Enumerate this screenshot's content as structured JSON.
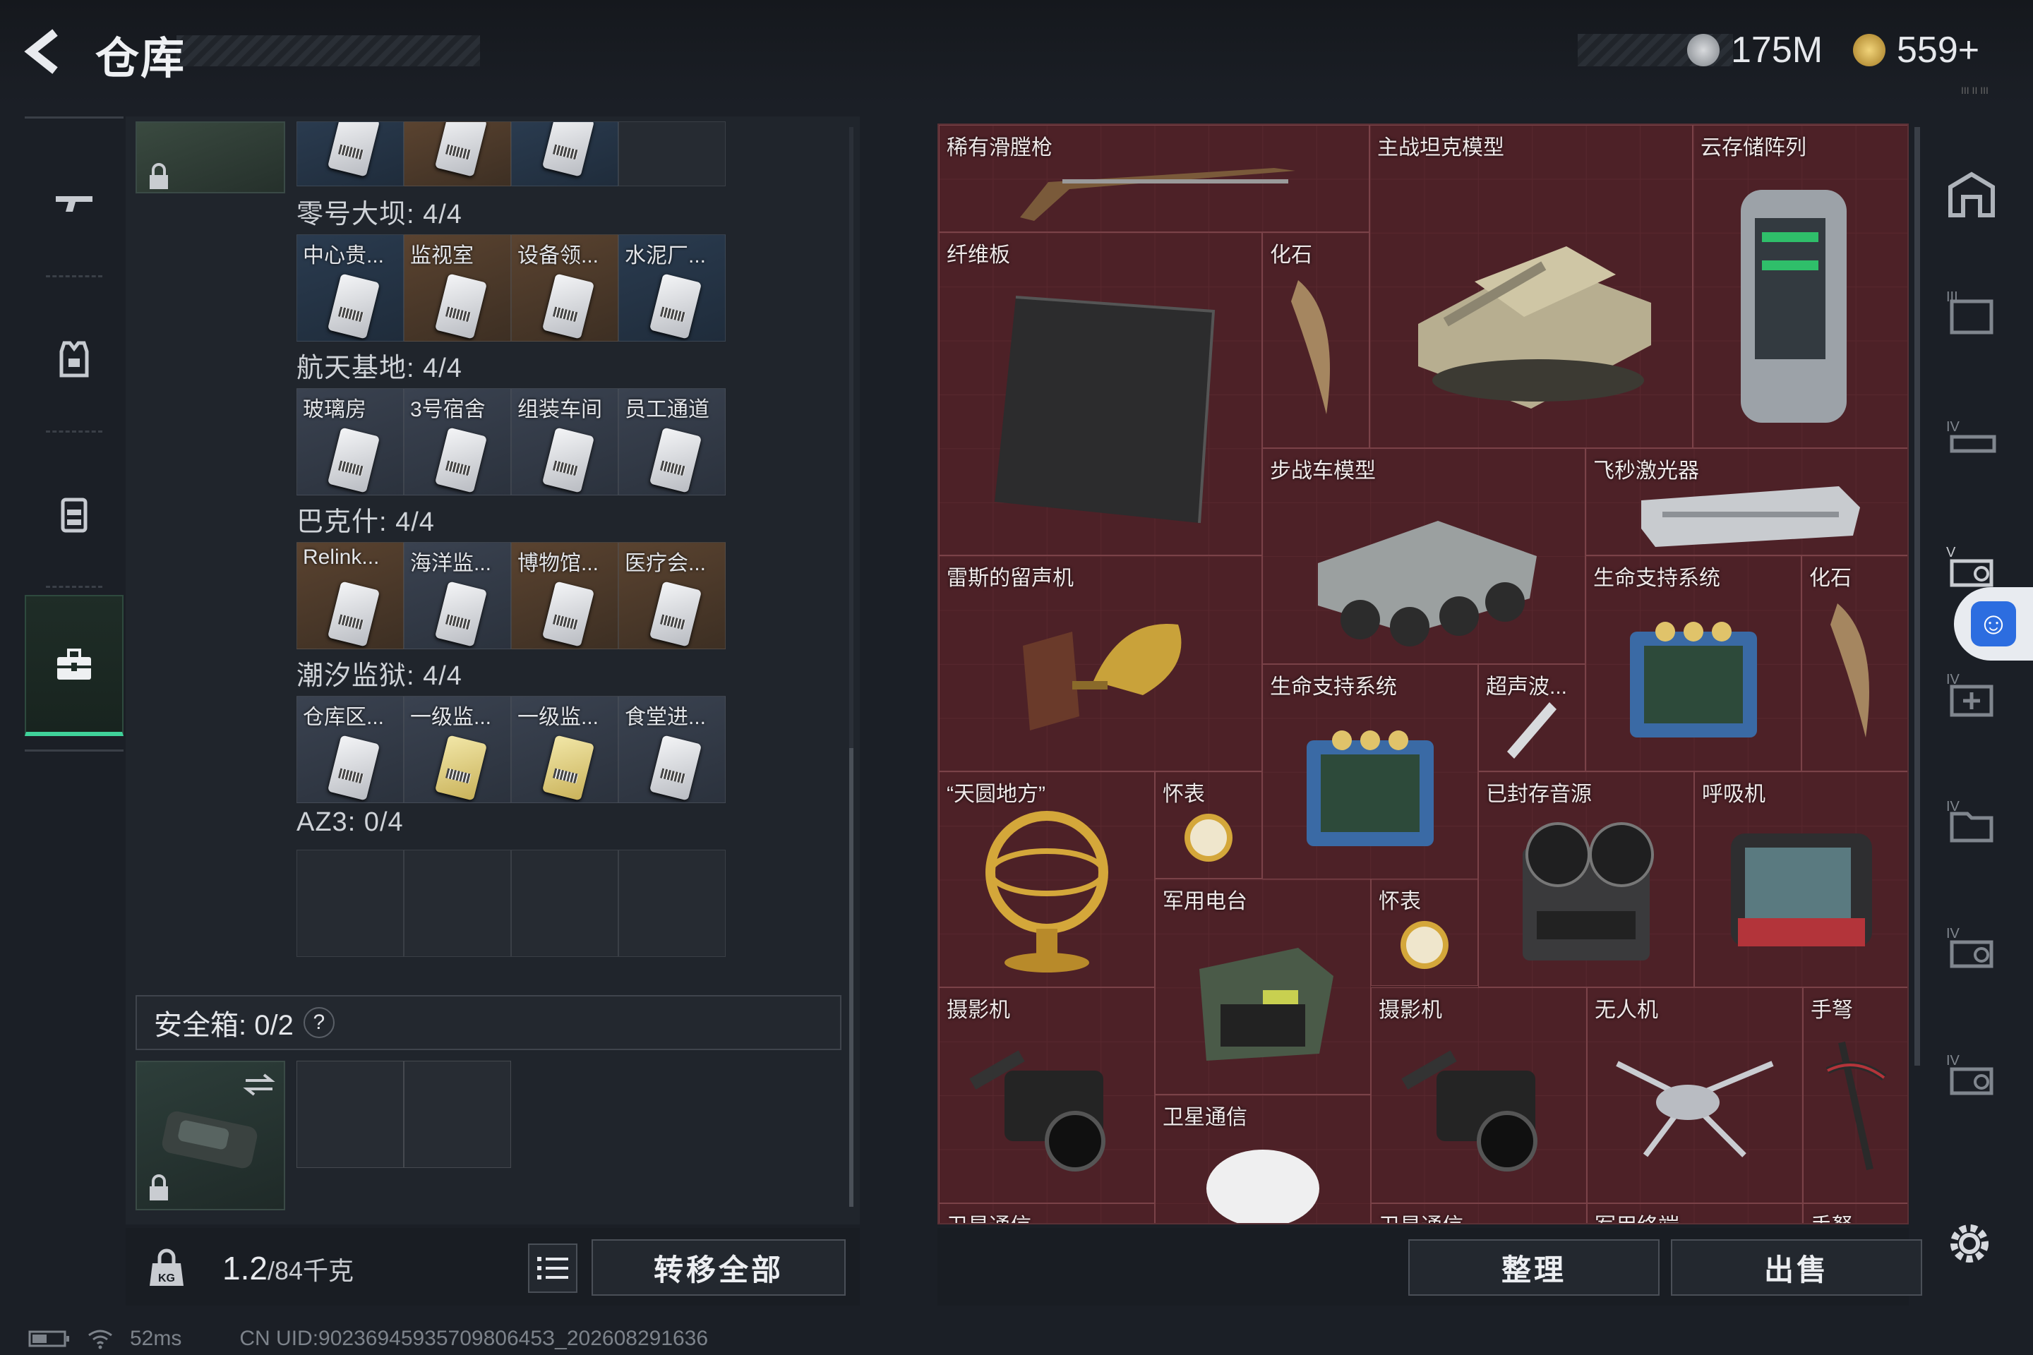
{
  "header": {
    "back_icon": "chevron-left-icon",
    "title": "仓库",
    "currency1": {
      "value": "175M",
      "icon": "silver-coin-icon"
    },
    "currency2": {
      "value": "559+",
      "icon": "gold-coin-icon"
    },
    "tiny_text": "III II III"
  },
  "leftnav": {
    "items": [
      {
        "icon": "gun-icon"
      },
      {
        "icon": "vest-icon"
      },
      {
        "icon": "backpack-icon"
      },
      {
        "icon": "toolbox-icon",
        "active": true
      }
    ]
  },
  "keycards": {
    "groups": [
      {
        "label": "零号大坝: 4/4",
        "cards": [
          {
            "label": "中心贵..."
          },
          {
            "label": "监视室"
          },
          {
            "label": "设备领..."
          },
          {
            "label": "水泥厂..."
          }
        ]
      },
      {
        "label": "航天基地: 4/4",
        "cards": [
          {
            "label": "玻璃房"
          },
          {
            "label": "3号宿舍"
          },
          {
            "label": "组装车间"
          },
          {
            "label": "员工通道"
          }
        ]
      },
      {
        "label": "巴克什: 4/4",
        "cards": [
          {
            "label": "Relink..."
          },
          {
            "label": "海洋监..."
          },
          {
            "label": "博物馆..."
          },
          {
            "label": "医疗会..."
          }
        ]
      },
      {
        "label": "潮汐监狱: 4/4",
        "cards": [
          {
            "label": "仓库区..."
          },
          {
            "label": "一级监..."
          },
          {
            "label": "一级监..."
          },
          {
            "label": "食堂进..."
          }
        ]
      },
      {
        "label": "AZ3: 0/4",
        "cards": []
      }
    ]
  },
  "safebox": {
    "label": "安全箱: 0/2",
    "help": "?"
  },
  "bottom": {
    "weight": "1.2",
    "weight_max": "/84千克",
    "transfer_all": "转移全部",
    "list_icon": "list-icon",
    "lock_icon": "weight-lock-icon"
  },
  "stash": {
    "items": [
      {
        "label": "稀有滑膛枪"
      },
      {
        "label": "主战坦克模型"
      },
      {
        "label": "云存储阵列"
      },
      {
        "label": "纤维板"
      },
      {
        "label": "化石"
      },
      {
        "label": "步战车模型"
      },
      {
        "label": "飞秒激光器"
      },
      {
        "label": "雷斯的留声机"
      },
      {
        "label": "生命支持系统"
      },
      {
        "label": "化石"
      },
      {
        "label": "生命支持系统"
      },
      {
        "label": "超声波..."
      },
      {
        "label": "“天圆地方”"
      },
      {
        "label": "怀表"
      },
      {
        "label": "已封存音源"
      },
      {
        "label": "呼吸机"
      },
      {
        "label": "军用电台"
      },
      {
        "label": "怀表"
      },
      {
        "label": "摄影机"
      },
      {
        "label": "摄影机"
      },
      {
        "label": "无人机"
      },
      {
        "label": "手弩"
      },
      {
        "label": "卫星通信"
      },
      {
        "label": "卫星通信"
      },
      {
        "label": "卫星通信"
      },
      {
        "label": "军用终端"
      },
      {
        "label": "手弩"
      }
    ]
  },
  "actions": {
    "sort": "整理",
    "sell": "出售"
  },
  "status": {
    "latency": "52ms",
    "uid": "CN UID:9023694593570980645З_202608291636"
  },
  "colors": {
    "accent_green": "#3fd29a",
    "stash_bg": "#4a2227",
    "panel_bg": "#20252c"
  }
}
